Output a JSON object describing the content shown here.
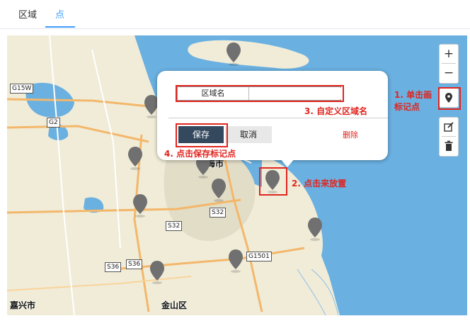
{
  "tabs": [
    {
      "label": "区域",
      "active": false
    },
    {
      "label": "点",
      "active": true
    }
  ],
  "map": {
    "places": {
      "jiaxing": "嘉兴市",
      "jinshan": "金山区",
      "shanghai_partial": "海市"
    },
    "road_labels": [
      "G15W",
      "G2",
      "S32",
      "S32",
      "S36",
      "S36",
      "G1501"
    ],
    "colors": {
      "water": "#6ab0e0",
      "land": "#f0ecd8",
      "urban": "#e2ddc7",
      "marker": "#707070"
    }
  },
  "controls": {
    "zoom_in_icon": "plus-icon",
    "zoom_out_icon": "minus-icon",
    "draw_marker_icon": "map-marker-icon",
    "edit_icon": "edit-icon",
    "delete_icon": "trash-icon"
  },
  "popup": {
    "name_label": "区域名",
    "name_value": "",
    "save_label": "保存",
    "cancel_label": "取消",
    "delete_label": "删除"
  },
  "annotations": {
    "step1_line1": "1. 单击画",
    "step1_line2": "标记点",
    "step2": "2. 点击来放置",
    "step3": "3. 自定义区域名",
    "step4": "4. 点击保存标记点",
    "color": "#e0251f"
  }
}
